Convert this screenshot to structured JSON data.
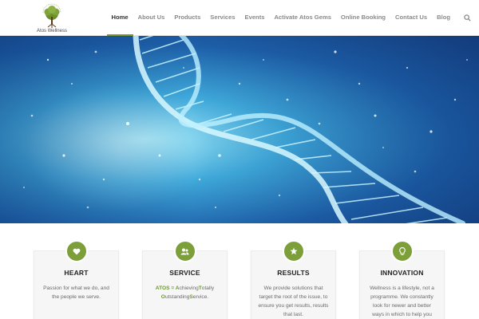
{
  "header": {
    "logo_text": "Atos Wellness",
    "logo_arc_text": "Nurturing from Within",
    "nav": [
      {
        "label": "Home",
        "active": true
      },
      {
        "label": "About Us",
        "active": false
      },
      {
        "label": "Products",
        "active": false
      },
      {
        "label": "Services",
        "active": false
      },
      {
        "label": "Events",
        "active": false
      },
      {
        "label": "Activate Atos Gems",
        "active": false
      },
      {
        "label": "Online Booking",
        "active": false
      },
      {
        "label": "Contact Us",
        "active": false
      },
      {
        "label": "Blog",
        "active": false
      }
    ],
    "search_icon": "search-icon"
  },
  "hero": {
    "image": "dna-helix-illustration"
  },
  "cards": [
    {
      "icon": "heart-icon",
      "title": "HEART",
      "text": "Passion for what we do, and the people we serve."
    },
    {
      "icon": "users-icon",
      "title": "SERVICE",
      "lines": [
        [
          {
            "t": "ATOS",
            "g": true
          },
          {
            "t": " = ",
            "g": true
          },
          {
            "t": "A",
            "g": true
          },
          {
            "t": "chieving",
            "g": false
          },
          {
            "t": "T",
            "g": true
          },
          {
            "t": "otally",
            "g": false
          }
        ],
        [
          {
            "t": "O",
            "g": true
          },
          {
            "t": "utstanding",
            "g": false
          },
          {
            "t": "S",
            "g": true
          },
          {
            "t": "ervice.",
            "g": false
          }
        ]
      ]
    },
    {
      "icon": "star-icon",
      "title": "RESULTS",
      "text": "We provide solutions that target the root of the issue, to ensure you get results, results that last."
    },
    {
      "icon": "lightbulb-icon",
      "title": "INNOVATION",
      "text": "Wellness is a lifestyle, not a programme. We constantly look for newer and better ways in which to help you"
    }
  ],
  "colors": {
    "accent": "#7c9f3a",
    "nav_active": "#333333",
    "nav": "#8a8a8a"
  }
}
